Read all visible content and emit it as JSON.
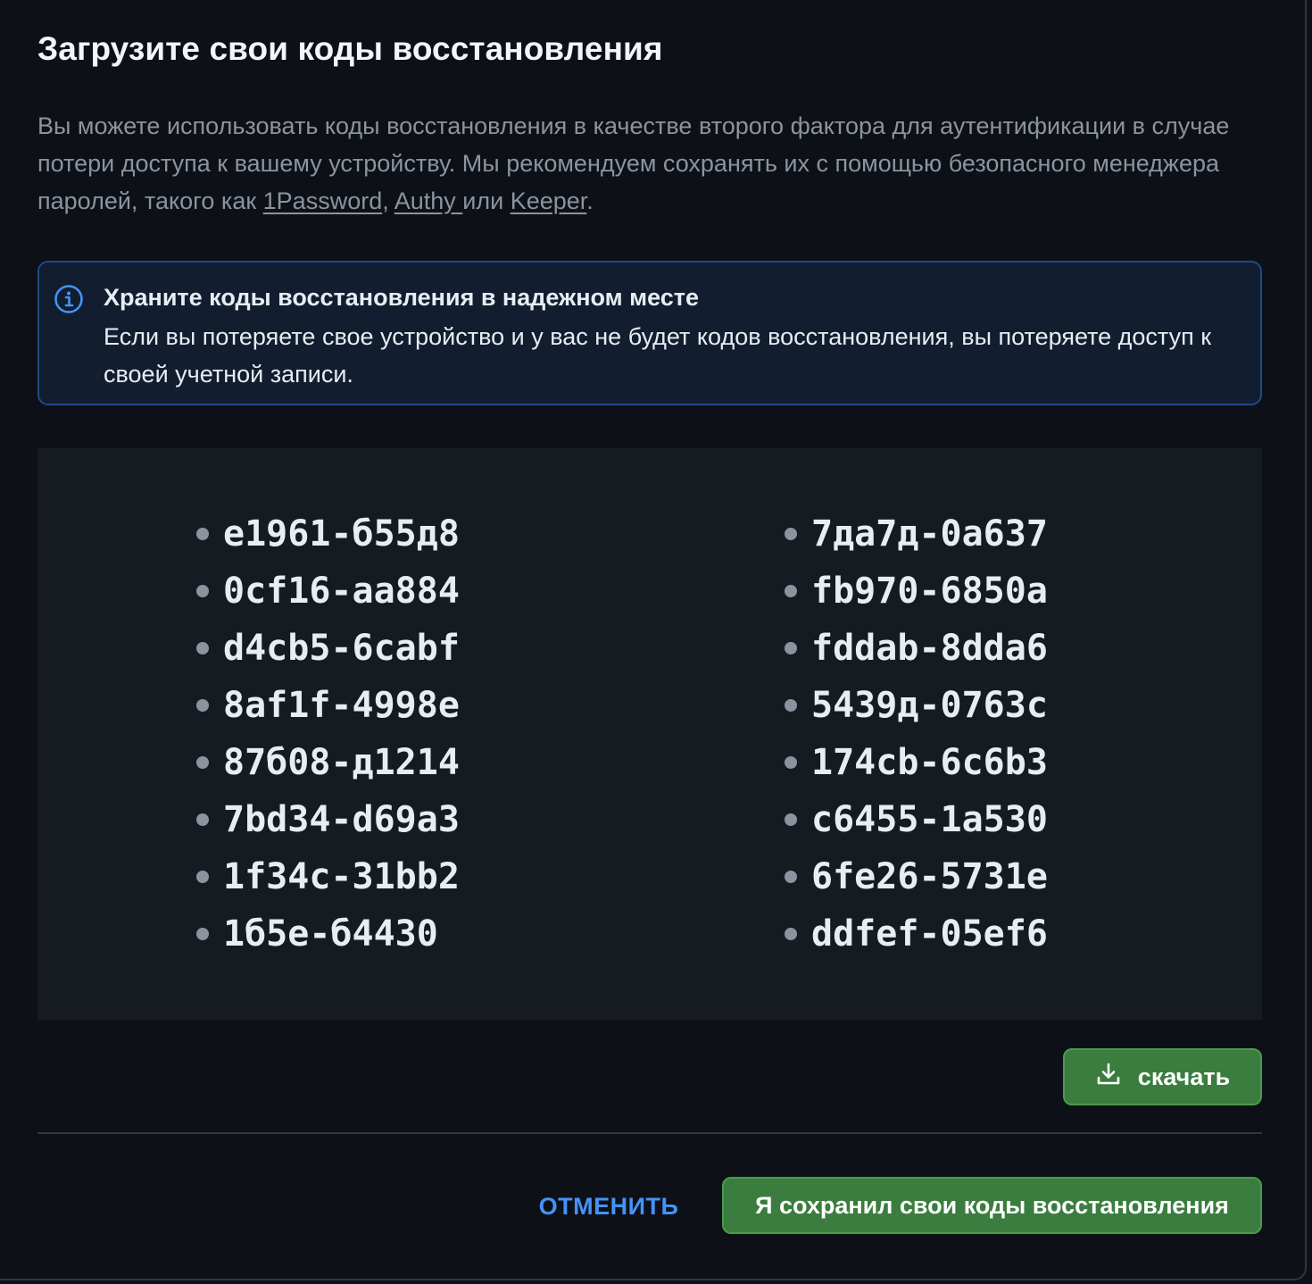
{
  "dialog": {
    "title": "Загрузите свои коды восстановления",
    "description": {
      "text_before": "Вы можете использовать коды восстановления в качестве второго фактора для аутентификации в случае потери доступа к вашему устройству. Мы рекомендуем сохранять их с помощью безопасного менеджера паролей, такого как ",
      "link_1": "1Password",
      "sep_1": ", ",
      "link_2": "Authy ",
      "sep_2": "или ",
      "link_3": "Keeper",
      "text_after": "."
    },
    "alert": {
      "icon": "info-icon",
      "title": "Храните коды восстановления в надежном месте",
      "body": "Если вы потеряете свое устройство и у вас не будет кодов восстановления, вы потеряете доступ к своей учетной записи."
    },
    "codes": {
      "left": [
        "e1961-б55д8",
        "0cf16-aa884",
        "d4cb5-6cabf",
        "8af1f-4998e",
        "87б08-д1214",
        "7bd34-d69a3",
        "1f34c-31bb2",
        "1б5е-б4430"
      ],
      "right": [
        "7да7д-0a637",
        "fb970-6850a",
        "fddab-8dda6",
        "5439д-0763c",
        "174cb-6c6b3",
        "c6455-1a530",
        "6fe26-5731e",
        "ddfef-05ef6"
      ]
    },
    "download_button": {
      "label": "скачать",
      "icon": "download-icon"
    },
    "cancel_button": {
      "label": "ОТМЕНИТЬ"
    },
    "confirm_button": {
      "label": "Я сохранил свои коды восстановления"
    }
  },
  "colors": {
    "background": "#0d1117",
    "alert_background": "#121d2f",
    "alert_border": "#1f4a8a",
    "codes_background": "#161b22",
    "primary_button": "#3a7d3e",
    "link_blue": "#4493f8",
    "muted_text": "#8b949e"
  }
}
